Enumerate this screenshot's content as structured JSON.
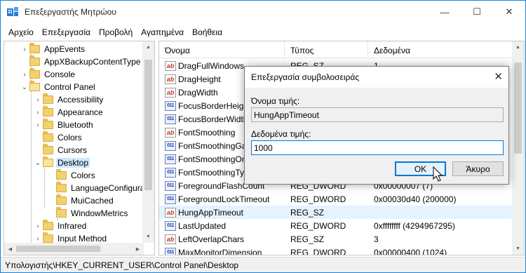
{
  "window": {
    "title": "Επεξεργαστής Μητρώου"
  },
  "title_controls": {
    "minimize": "—",
    "maximize": "☐",
    "close": "✕"
  },
  "menu": [
    "Αρχείο",
    "Επεξεργασία",
    "Προβολή",
    "Αγαπημένα",
    "Βοήθεια"
  ],
  "tree": [
    {
      "label": "AppEvents",
      "chev": "›"
    },
    {
      "label": "AppXBackupContentType",
      "chev": ""
    },
    {
      "label": "Console",
      "chev": "›"
    },
    {
      "label": "Control Panel",
      "chev": "⌄"
    },
    {
      "label": "Accessibility",
      "chev": "›"
    },
    {
      "label": "Appearance",
      "chev": "›"
    },
    {
      "label": "Bluetooth",
      "chev": "›"
    },
    {
      "label": "Colors",
      "chev": ""
    },
    {
      "label": "Cursors",
      "chev": ""
    },
    {
      "label": "Desktop",
      "chev": "⌄"
    },
    {
      "label": "Colors",
      "chev": ""
    },
    {
      "label": "LanguageConfigura",
      "chev": ""
    },
    {
      "label": "MuiCached",
      "chev": ""
    },
    {
      "label": "WindowMetrics",
      "chev": ""
    },
    {
      "label": "Infrared",
      "chev": "›"
    },
    {
      "label": "Input Method",
      "chev": "›"
    }
  ],
  "list": {
    "columns": [
      "Όνομα",
      "Τύπος",
      "Δεδομένα"
    ],
    "rows": [
      {
        "name": "DragFullWindows",
        "type": "REG_SZ",
        "data": "1",
        "icon": "sz"
      },
      {
        "name": "DragHeight",
        "type": "",
        "data": "",
        "icon": "sz"
      },
      {
        "name": "DragWidth",
        "type": "",
        "data": "",
        "icon": "sz"
      },
      {
        "name": "FocusBorderHeig",
        "type": "",
        "data": "",
        "icon": "dword"
      },
      {
        "name": "FocusBorderWidth",
        "type": "",
        "data": "",
        "icon": "dword"
      },
      {
        "name": "FontSmoothing",
        "type": "",
        "data": "",
        "icon": "sz"
      },
      {
        "name": "FontSmoothingGa",
        "type": "",
        "data": "",
        "icon": "dword"
      },
      {
        "name": "FontSmoothingOr",
        "type": "",
        "data": "",
        "icon": "dword"
      },
      {
        "name": "FontSmoothingTyp",
        "type": "",
        "data": "",
        "icon": "dword"
      },
      {
        "name": "ForegroundFlashCount",
        "type": "REG_DWORD",
        "data": "0x00000007 (7)",
        "icon": "dword"
      },
      {
        "name": "ForegroundLockTimeout",
        "type": "REG_DWORD",
        "data": "0x00030d40 (200000)",
        "icon": "dword"
      },
      {
        "name": "HungAppTimeout",
        "type": "REG_SZ",
        "data": "",
        "icon": "sz"
      },
      {
        "name": "LastUpdated",
        "type": "REG_DWORD",
        "data": "0xffffffff (4294967295)",
        "icon": "dword"
      },
      {
        "name": "LeftOverlapChars",
        "type": "REG_SZ",
        "data": "3",
        "icon": "sz"
      },
      {
        "name": "MaxMonitorDimension",
        "type": "REG_DWORD",
        "data": "0x00000400 (1024)",
        "icon": "dword"
      }
    ]
  },
  "icons": {
    "sz": "ab",
    "dword": "011"
  },
  "statusbar": {
    "path": "Υπολογιστής\\HKEY_CURRENT_USER\\Control Panel\\Desktop"
  },
  "dialog": {
    "title": "Επεξεργασία συμβολοσειράς",
    "close": "✕",
    "name_label": "Όνομα τιμής:",
    "name_value": "HungAppTimeout",
    "data_label": "Δεδομένα τιμής:",
    "data_value": "1000",
    "ok": "OK",
    "cancel": "Άκυρο"
  },
  "accent_color": "#0078d7"
}
